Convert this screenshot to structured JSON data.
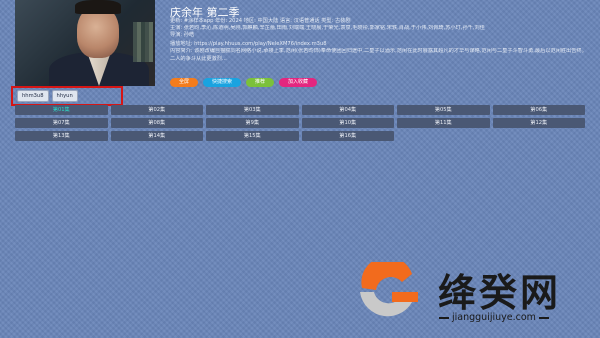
{
  "show": {
    "title": "庆余年 第二季",
    "meta_row1": "更新: #涂样本app  年份: 2024  地区: 中国大陆  语言: 汉语普通话  类型: 古装剧",
    "meta_row2": "主演: 张若昀,李沁,陈道明,吴刚,郭麒麟,辛芷蕾,田雨,刘端端,王晓晨,于荣光,袁泉,毛晓彤,郭家铭,宋轶,肖战,于小伟,刘佩琦,苏小玎,孙千,刘佳",
    "meta_row3": "导演: 孙皓",
    "meta_row4": "播放地址: https://play.hhuus.com/play/NeleXM76/index.m3u8",
    "meta_row5": "内容简介: 该剧改编自猫腻同名网络小说,承接上季,范闲(张若昀饰)奉命使团回归途中,二皇子以酒示,范闲在此时展露其超凡的才华与谋略,范闲与二皇子斗智斗勇,最后以范闲胜出告终。二人的争斗从此更激烈..."
  },
  "actions": [
    {
      "label": "全屏",
      "color": "#f47c1c"
    },
    {
      "label": "快捷搜索",
      "color": "#1aa3e0"
    },
    {
      "label": "推荐",
      "color": "#7bc13a"
    },
    {
      "label": "加入收藏",
      "color": "#e4267f"
    }
  ],
  "sources": [
    "hhm3u8",
    "hhyun"
  ],
  "episodes": [
    "第01集",
    "第02集",
    "第03集",
    "第04集",
    "第05集",
    "第06集",
    "第07集",
    "第08集",
    "第9集",
    "第10集",
    "第11集",
    "第12集",
    "第13集",
    "第14集",
    "第15集",
    "第16集"
  ],
  "active_episode_index": 0,
  "watermark": {
    "name": "绛癸网",
    "url": "jiangguijiuye.com",
    "colors": {
      "orange": "#f26b1d",
      "gray": "#c9c9c9"
    }
  }
}
